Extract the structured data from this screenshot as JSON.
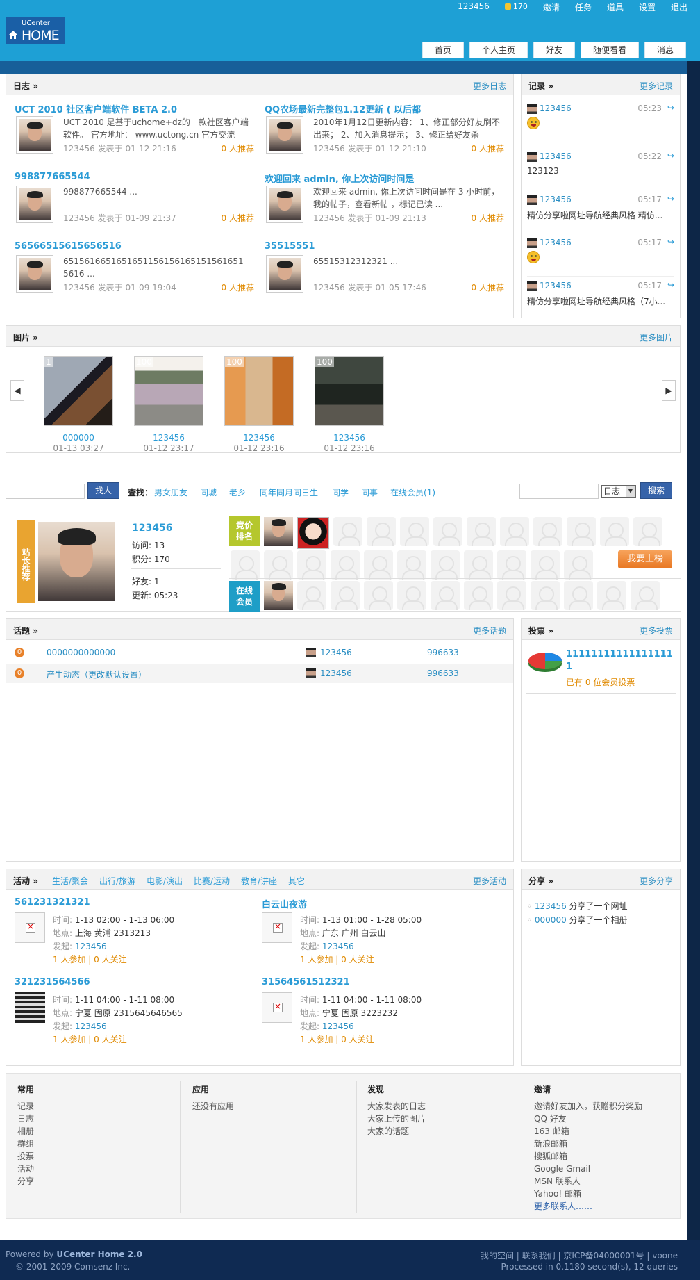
{
  "topbar": {
    "user": "123456",
    "coins": "170",
    "links": [
      "邀请",
      "任务",
      "道具",
      "设置",
      "退出"
    ]
  },
  "logo": {
    "line1": "UCenter",
    "line2": "HOME"
  },
  "nav": [
    "首页",
    "个人主页",
    "好友",
    "随便看看",
    "消息"
  ],
  "blog": {
    "title": "日志",
    "more": "更多日志",
    "items": [
      {
        "title": "UCT 2010 社区客户端软件  BETA 2.0",
        "body": "UCT 2010 是基于uchome+dz的一款社区客户端软件。 官方地址： www.uctong.cn 官方交流",
        "author": "123456",
        "date": "发表于  01-12 21:16",
        "rec": "0 人推荐"
      },
      {
        "title": "QQ农场最新完整包1.12更新 ( 以后都",
        "body": "2010年1月12日更新内容： 1、修正部分好友刷不出来； 2、加入消息提示； 3、修正给好友杀",
        "author": "123456",
        "date": "发表于  01-12 21:10",
        "rec": "0 人推荐"
      },
      {
        "title": "998877665544",
        "body": "998877665544 ...",
        "author": "123456",
        "date": "发表于  01-09 21:37",
        "rec": "0 人推荐"
      },
      {
        "title": "欢迎回来  admin, 你上次访问时间是",
        "body": "欢迎回来 admin, 你上次访问时间是在 3 小时前，我的帖子，查看新帖 ，标记已读 ...",
        "author": "123456",
        "date": "发表于  01-09 21:13",
        "rec": "0 人推荐"
      },
      {
        "title": "56566515615656516",
        "body": "6515616651651651156156165151561651 5616 ...",
        "author": "123456",
        "date": "发表于  01-09 19:04",
        "rec": "0 人推荐"
      },
      {
        "title": "35515551",
        "body": "65515312312321 ...",
        "author": "123456",
        "date": "发表于  01-05 17:46",
        "rec": "0 人推荐"
      }
    ]
  },
  "records": {
    "title": "记录",
    "more": "更多记录",
    "items": [
      {
        "user": "123456",
        "time": "05:23",
        "text": ""
      },
      {
        "user": "123456",
        "time": "05:22",
        "text": "123123"
      },
      {
        "user": "123456",
        "time": "05:17",
        "text": "精仿分享啦网址导航经典风格 精仿..."
      },
      {
        "user": "123456",
        "time": "05:17",
        "text": ""
      },
      {
        "user": "123456",
        "time": "05:17",
        "text": "精仿分享啦网址导航经典风格（7小..."
      }
    ]
  },
  "photos": {
    "title": "图片",
    "more": "更多图片",
    "items": [
      {
        "count": "1",
        "name": "000000",
        "date": "01-13 03:27"
      },
      {
        "count": "100",
        "name": "123456",
        "date": "01-12 23:17"
      },
      {
        "count": "100",
        "name": "123456",
        "date": "01-12 23:16"
      },
      {
        "count": "100",
        "name": "123456",
        "date": "01-12 23:16"
      }
    ]
  },
  "search": {
    "find_btn": "找人",
    "find_label": "查找：",
    "filters": [
      "男女朋友",
      "同城",
      "老乡",
      "同年同月同日生",
      "同学",
      "同事",
      "在线会员(1)"
    ],
    "select_value": "日志",
    "search_btn": "搜索"
  },
  "star": {
    "tag": "站长推荐",
    "name": "123456",
    "visits": "访问: 13",
    "points": "积分: 170",
    "friends": "好友: 1",
    "updated": "更新: 05:23"
  },
  "ranking": {
    "tag1": "竞价排名",
    "tag2": "在线会员",
    "btn": "我要上榜"
  },
  "topics": {
    "title": "话题",
    "more": "更多话题",
    "items": [
      {
        "num": "0",
        "name": "0000000000000",
        "user": "123456",
        "id": "996633"
      },
      {
        "num": "0",
        "name": "产生动态（更改默认设置）",
        "user": "123456",
        "id": "996633"
      }
    ]
  },
  "polls": {
    "title": "投票",
    "more": "更多投票",
    "name": "11111111111111111 1",
    "stat_a": "已有",
    "stat_b": "0 位会员投票"
  },
  "events": {
    "title": "活动",
    "more": "更多活动",
    "cats": [
      "生活/聚会",
      "出行/旅游",
      "电影/演出",
      "比赛/运动",
      "教育/讲座",
      "其它"
    ],
    "labels": {
      "time": "时间:",
      "place": "地点:",
      "host": "发起:"
    },
    "items": [
      {
        "title": "561231321321",
        "time": "1-13 02:00 - 1-13 06:00",
        "place": "上海  黄浦  2313213",
        "host": "123456",
        "join": "1 人参加",
        "follow": "0 人关注"
      },
      {
        "title": "白云山夜游",
        "time": "1-13 01:00 - 1-28 05:00",
        "place": "广东  广州  白云山",
        "host": "123456",
        "join": "1 人参加",
        "follow": "0 人关注"
      },
      {
        "title": "321231564566",
        "time": "1-11 04:00 - 1-11 08:00",
        "place": "宁夏  固原  2315645646565",
        "host": "123456",
        "join": "1 人参加",
        "follow": "0 人关注"
      },
      {
        "title": "31564561512321",
        "time": "1-11 04:00 - 1-11 08:00",
        "place": "宁夏  固原  3223232",
        "host": "123456",
        "join": "1 人参加",
        "follow": "0 人关注"
      }
    ]
  },
  "shares": {
    "title": "分享",
    "more": "更多分享",
    "items": [
      {
        "user": "123456",
        "text": "分享了一个网址"
      },
      {
        "user": "000000",
        "text": "分享了一个相册"
      }
    ]
  },
  "footer": {
    "cols": [
      {
        "h": "常用",
        "items": [
          "记录",
          "日志",
          "相册",
          "群组",
          "投票",
          "活动",
          "分享"
        ]
      },
      {
        "h": "应用",
        "items": [
          "还没有应用"
        ]
      },
      {
        "h": "发现",
        "items": [
          "大家发表的日志",
          "大家上传的图片",
          "大家的话题"
        ]
      },
      {
        "h": "邀请",
        "items": [
          "邀请好友加入，获赠积分奖励",
          "QQ 好友",
          "163 邮箱",
          "新浪邮箱",
          "搜狐邮箱",
          "Google Gmail",
          "MSN 联系人",
          "Yahoo! 邮箱",
          "更多联系人……"
        ]
      }
    ]
  },
  "bottom": {
    "powered": "Powered by",
    "brand": "UCenter Home 2.0",
    "copy": "© 2001-2009 Comsenz Inc.",
    "links": "我的空间 | 联系我们 | 京ICP备04000001号 | voone",
    "processed": "Processed in 0.1180 second(s), 12 queries"
  }
}
